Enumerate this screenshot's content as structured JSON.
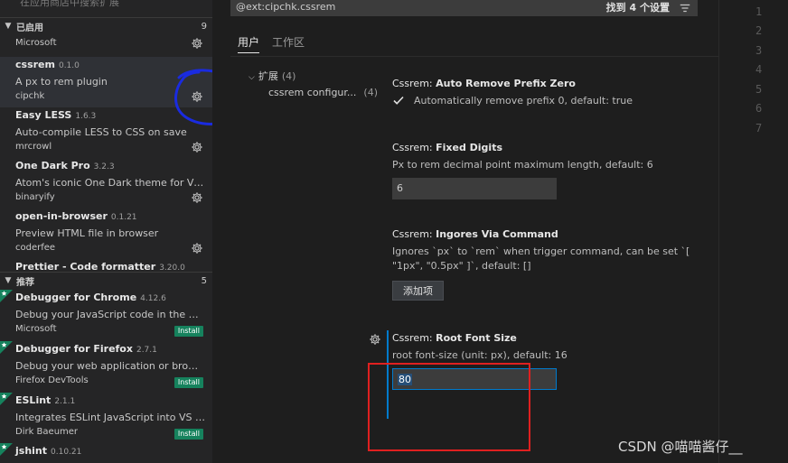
{
  "sidebar": {
    "search_hint": "在应用商店中搜索扩展",
    "enabled_section": {
      "label": "已启用",
      "count": "9"
    },
    "recommended_section": {
      "label": "推荐",
      "count": "5"
    },
    "enabled": [
      {
        "name": "",
        "version": "",
        "description": "",
        "publisher": "Microsoft",
        "action": "gear"
      },
      {
        "name": "cssrem",
        "version": "0.1.0",
        "description": "A px to rem plugin",
        "publisher": "cipchk",
        "action": "gear"
      },
      {
        "name": "Easy LESS",
        "version": "1.6.3",
        "description": "Auto-compile LESS to CSS on save",
        "publisher": "mrcrowl",
        "action": "gear"
      },
      {
        "name": "One Dark Pro",
        "version": "3.2.3",
        "description": "Atom's iconic One Dark theme for Vis...",
        "publisher": "binaryify",
        "action": "gear"
      },
      {
        "name": "open-in-browser",
        "version": "0.1.21",
        "description": "Preview HTML file in browser",
        "publisher": "coderfee",
        "action": "gear"
      },
      {
        "name": "Prettier - Code formatter",
        "version": "3.20.0",
        "description": "",
        "publisher": "",
        "action": ""
      }
    ],
    "recommended": [
      {
        "name": "Debugger for Chrome",
        "version": "4.12.6",
        "description": "Debug your JavaScript code in the Ch...",
        "publisher": "Microsoft",
        "install_label": "Install"
      },
      {
        "name": "Debugger for Firefox",
        "version": "2.7.1",
        "description": "Debug your web application or brows...",
        "publisher": "Firefox DevTools",
        "install_label": "Install"
      },
      {
        "name": "ESLint",
        "version": "2.1.1",
        "description": "Integrates ESLint JavaScript into VS C...",
        "publisher": "Dirk Baeumer",
        "install_label": "Install"
      },
      {
        "name": "jshint",
        "version": "0.10.21",
        "description": "",
        "publisher": "",
        "install_label": ""
      }
    ]
  },
  "settings": {
    "search_value": "@ext:cipchk.cssrem",
    "found_label": "找到 4 个设置",
    "tabs": [
      {
        "label": "用户"
      },
      {
        "label": "工作区"
      }
    ],
    "toc": {
      "group_label": "扩展",
      "group_count": "(4)",
      "item_label": "cssrem configur...",
      "item_count": "(4)"
    },
    "items": [
      {
        "category": "Cssrem: ",
        "name": "Auto Remove Prefix Zero",
        "description": "Automatically remove prefix 0, default: true",
        "checked": true
      },
      {
        "category": "Cssrem: ",
        "name": "Fixed Digits",
        "description": "Px to rem decimal point maximum length, default: 6",
        "value": "6"
      },
      {
        "category": "Cssrem: ",
        "name": "Ingores Via Command",
        "description": "Ignores `px` to `rem` when trigger command, can be set `[ \"1px\", \"0.5px\" ]`, default: []",
        "button_label": "添加项"
      },
      {
        "category": "Cssrem: ",
        "name": "Root Font Size",
        "description": "root font-size (unit: px), default: 16",
        "value": "80"
      }
    ]
  },
  "editor": {
    "line_numbers": [
      "1",
      "2",
      "3",
      "4",
      "5",
      "6",
      "7"
    ]
  },
  "watermark": "CSDN @喵喵酱仔__",
  "colors": {
    "accent_blue": "#007acc",
    "install_green": "#16825d",
    "annotation_red": "#e02020",
    "annotation_blue": "#1a2be0"
  }
}
